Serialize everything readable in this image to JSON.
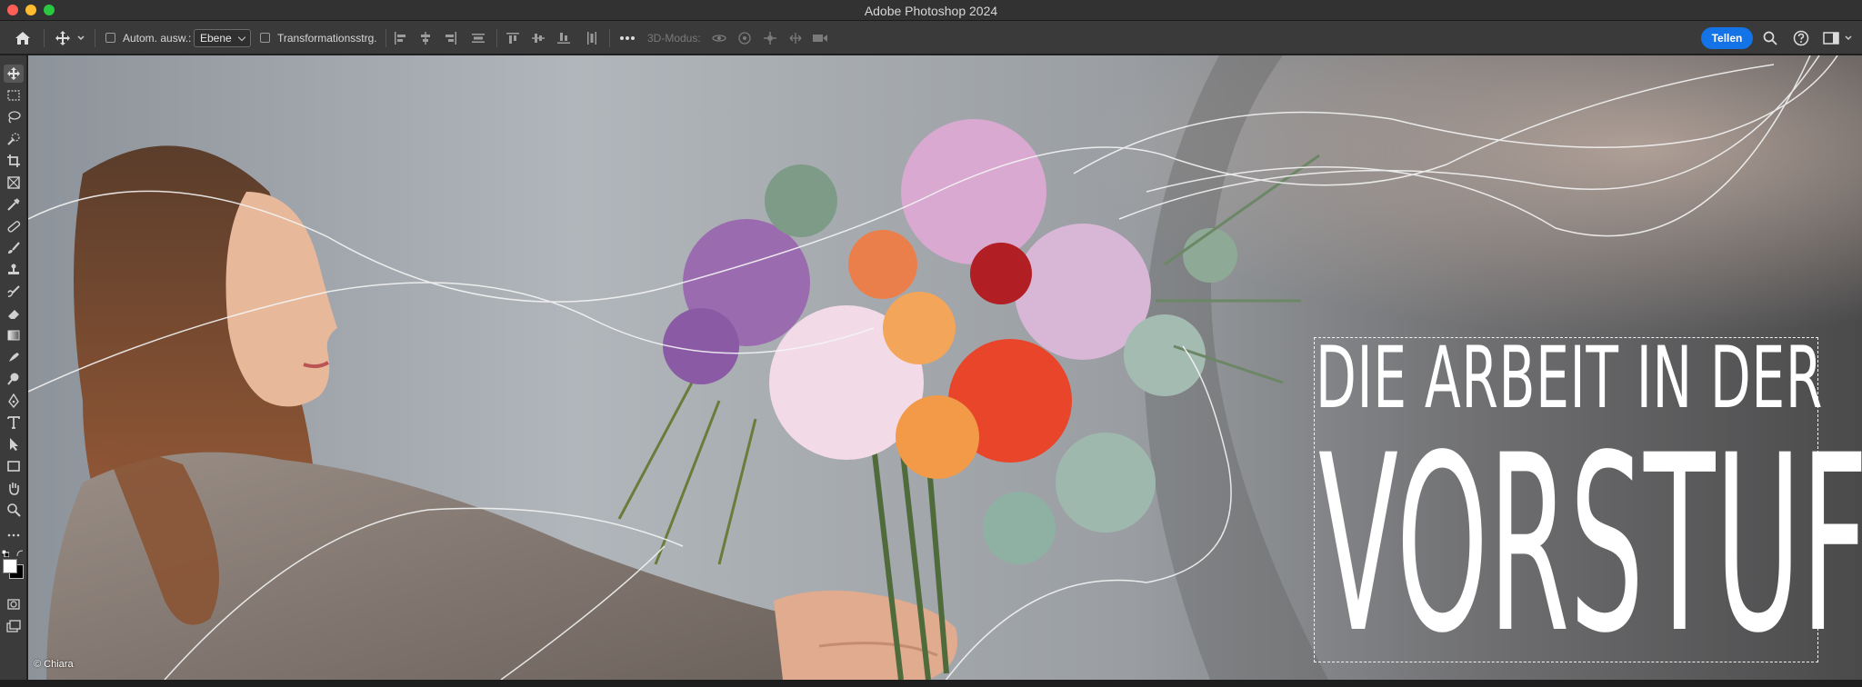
{
  "window": {
    "title": "Adobe Photoshop 2024"
  },
  "traffic_colors": {
    "close": "#ff5f57",
    "minimize": "#febc2e",
    "zoom": "#28c840"
  },
  "options_bar": {
    "auto_select_label": "Autom. ausw.:",
    "auto_select_value": "Ebene",
    "transform_controls_label": "Transformationsstrg.",
    "three_d_mode_label": "3D-Modus:",
    "share_label": "Tellen",
    "share_color": "#1473e6"
  },
  "toolbar_icons": [
    "move-icon",
    "marquee-icon",
    "lasso-icon",
    "quick-selection-icon",
    "crop-icon",
    "frame-icon",
    "eyedropper-icon",
    "healing-brush-icon",
    "brush-icon",
    "clone-stamp-icon",
    "history-brush-icon",
    "eraser-icon",
    "gradient-icon",
    "smudge-icon",
    "dodge-icon",
    "pen-icon",
    "type-icon",
    "path-selection-icon",
    "rectangle-icon",
    "hand-icon",
    "zoom-icon",
    "more-tools-icon"
  ],
  "canvas": {
    "headline_line1": "DIE ARBEIT IN DER",
    "headline_line2": "VORSTUFE",
    "credit": "© Chiara"
  }
}
